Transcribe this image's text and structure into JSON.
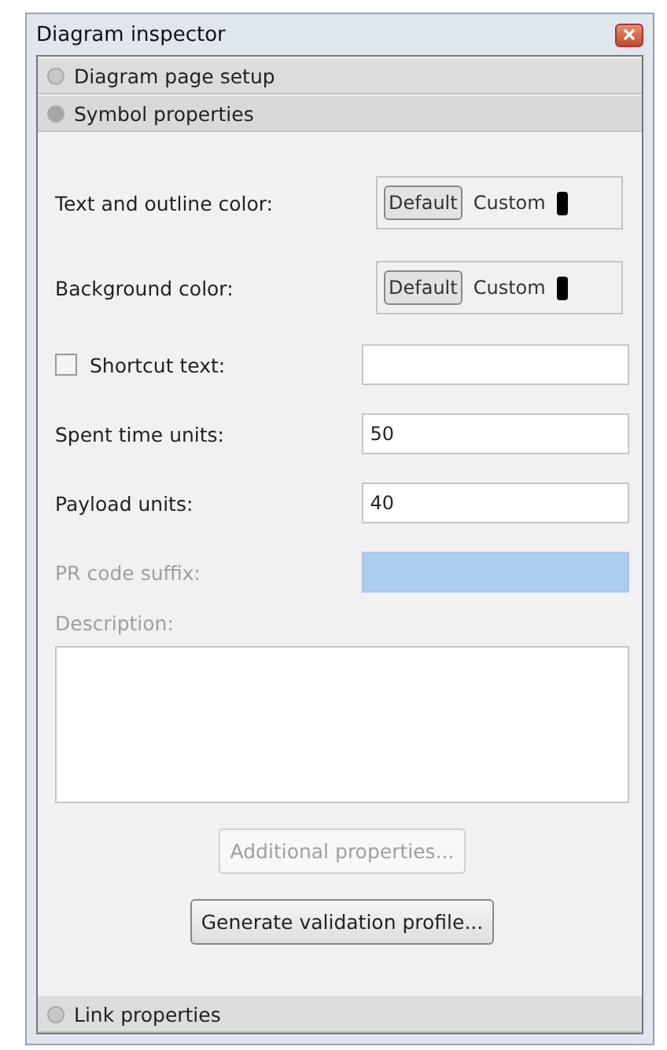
{
  "window": {
    "title": "Diagram inspector"
  },
  "sections": [
    {
      "title": "Diagram page setup",
      "expanded": false
    },
    {
      "title": "Symbol properties",
      "expanded": true,
      "rows": [
        {
          "kind": "color",
          "label": "Text and outline color:",
          "options": [
            {
              "label": "Default",
              "selected": true
            },
            {
              "label": "Custom",
              "selected": false
            }
          ]
        },
        {
          "kind": "color",
          "label": "Background color:",
          "options": [
            {
              "label": "Default",
              "selected": true
            },
            {
              "label": "Custom",
              "selected": false
            }
          ]
        },
        {
          "kind": "checkfield",
          "label": "Shortcut text:",
          "checked": false
        },
        {
          "kind": "field",
          "label": "Spent time units:",
          "value": "50",
          "disabled": false
        },
        {
          "kind": "field",
          "label": "Payload units:",
          "value": "40",
          "disabled": false
        },
        {
          "kind": "field",
          "label": "PR code suffix:",
          "disabled": true
        },
        {
          "kind": "textarea",
          "label": "Description:",
          "disabled": true
        }
      ],
      "buttons": [
        {
          "label": "Additional properties...",
          "disabled": true
        },
        {
          "label": "Generate validation profile...",
          "disabled": false
        }
      ]
    },
    {
      "title": "Link properties",
      "expanded": false
    }
  ]
}
